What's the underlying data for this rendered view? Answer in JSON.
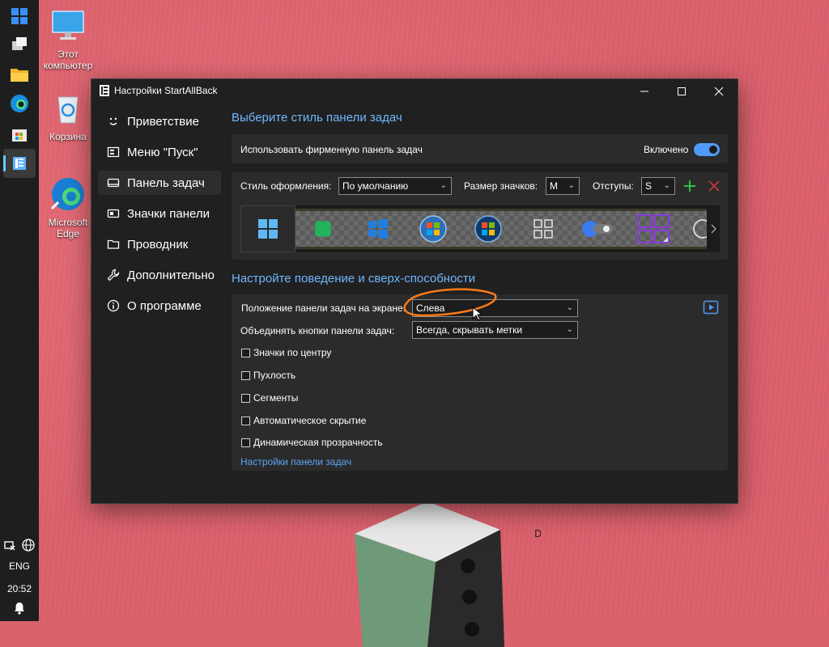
{
  "desktop": {
    "icons": [
      {
        "label": "Этот компьютер"
      },
      {
        "label": "Корзина"
      },
      {
        "label": "Microsoft Edge"
      }
    ]
  },
  "taskbar": {
    "language": "ENG",
    "time": "20:52"
  },
  "window": {
    "title": "Настройки StartAllBack",
    "sidebar": [
      {
        "label": "Приветствие",
        "icon": "smile-icon"
      },
      {
        "label": "Меню \"Пуск\"",
        "icon": "start-menu-icon"
      },
      {
        "label": "Панель задач",
        "icon": "taskbar-icon",
        "selected": true
      },
      {
        "label": "Значки панели",
        "icon": "tray-icons-icon"
      },
      {
        "label": "Проводник",
        "icon": "folder-icon"
      },
      {
        "label": "Дополнительно",
        "icon": "wrench-icon"
      },
      {
        "label": "О программе",
        "icon": "info-icon"
      }
    ],
    "style_section": {
      "title": "Выберите стиль панели задач",
      "branded_label": "Использовать фирменную панель задач",
      "branded_state": "Включено",
      "style_label": "Стиль оформления:",
      "style_value": "По умолчанию",
      "icon_size_label": "Размер значков:",
      "icon_size_value": "M",
      "padding_label": "Отступы:",
      "padding_value": "S"
    },
    "behavior_section": {
      "title": "Настройте поведение и сверх-способности",
      "position_label": "Положение панели задач на экране:",
      "position_value": "Слева",
      "combine_label": "Объединять кнопки панели задач:",
      "combine_value": "Всегда, скрывать метки",
      "checkboxes": [
        {
          "label": "Значки по центру",
          "checked": false
        },
        {
          "label": "Пухлость",
          "checked": false
        },
        {
          "label": "Сегменты",
          "checked": false
        },
        {
          "label": "Автоматическое скрытие",
          "checked": false
        },
        {
          "label": "Динамическая прозрачность",
          "checked": false
        }
      ],
      "link": "Настройки панели задач"
    }
  },
  "colors": {
    "accent": "#4e9cf7",
    "section_title": "#6fb7ff",
    "wallpaper": "#d95f6a",
    "highlight": "#ff7a1a"
  }
}
